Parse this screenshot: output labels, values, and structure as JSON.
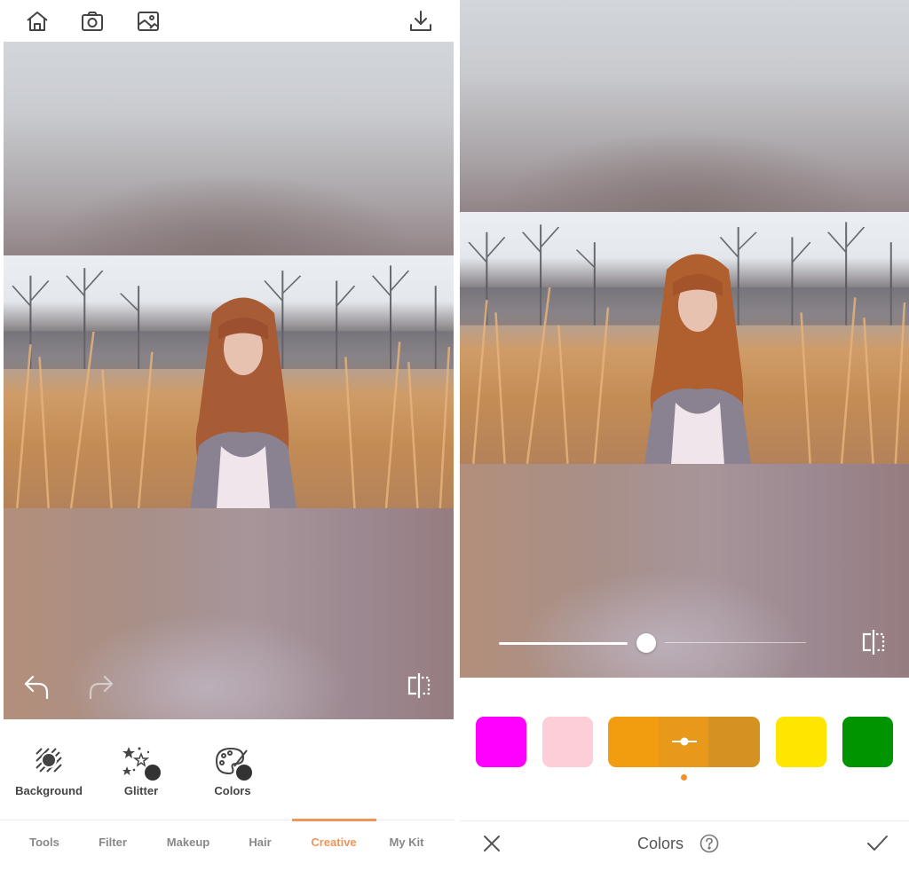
{
  "left_screen": {
    "topbar": {
      "icons": [
        "home-icon",
        "camera-icon",
        "gallery-icon",
        "download-icon"
      ]
    },
    "canvas_controls": {
      "undo_icon": "undo-icon",
      "redo_icon": "redo-icon",
      "compare_icon": "compare-icon"
    },
    "features": [
      {
        "label": "Background",
        "icon": "background-icon",
        "badge": false
      },
      {
        "label": "Glitter",
        "icon": "glitter-icon",
        "badge": true
      },
      {
        "label": "Colors",
        "icon": "palette-icon",
        "badge": true
      }
    ],
    "tabs": [
      {
        "label": "Tools",
        "active": false
      },
      {
        "label": "Filter",
        "active": false
      },
      {
        "label": "Makeup",
        "active": false
      },
      {
        "label": "Hair",
        "active": false
      },
      {
        "label": "Creative",
        "active": true
      },
      {
        "label": "My Kit",
        "active": false
      }
    ],
    "accent_color": "#f0945a"
  },
  "right_screen": {
    "intensity_slider": {
      "value_percent": 48
    },
    "compare_icon": "compare-icon",
    "swatches": [
      {
        "color": "#ff00ff",
        "selected": false
      },
      {
        "color": "#fdcdd8",
        "selected": false
      },
      {
        "color": "#f29c10",
        "selected": true,
        "shades": [
          "#f29c10",
          "#e9991a",
          "#d69220"
        ]
      },
      {
        "color": "#ffe600",
        "selected": false
      },
      {
        "color": "#009400",
        "selected": false
      }
    ],
    "bottom_bar": {
      "title": "Colors",
      "cancel_icon": "close-icon",
      "help_icon": "help-icon",
      "confirm_icon": "check-icon"
    },
    "selection_dot_color": "#f0922a"
  }
}
